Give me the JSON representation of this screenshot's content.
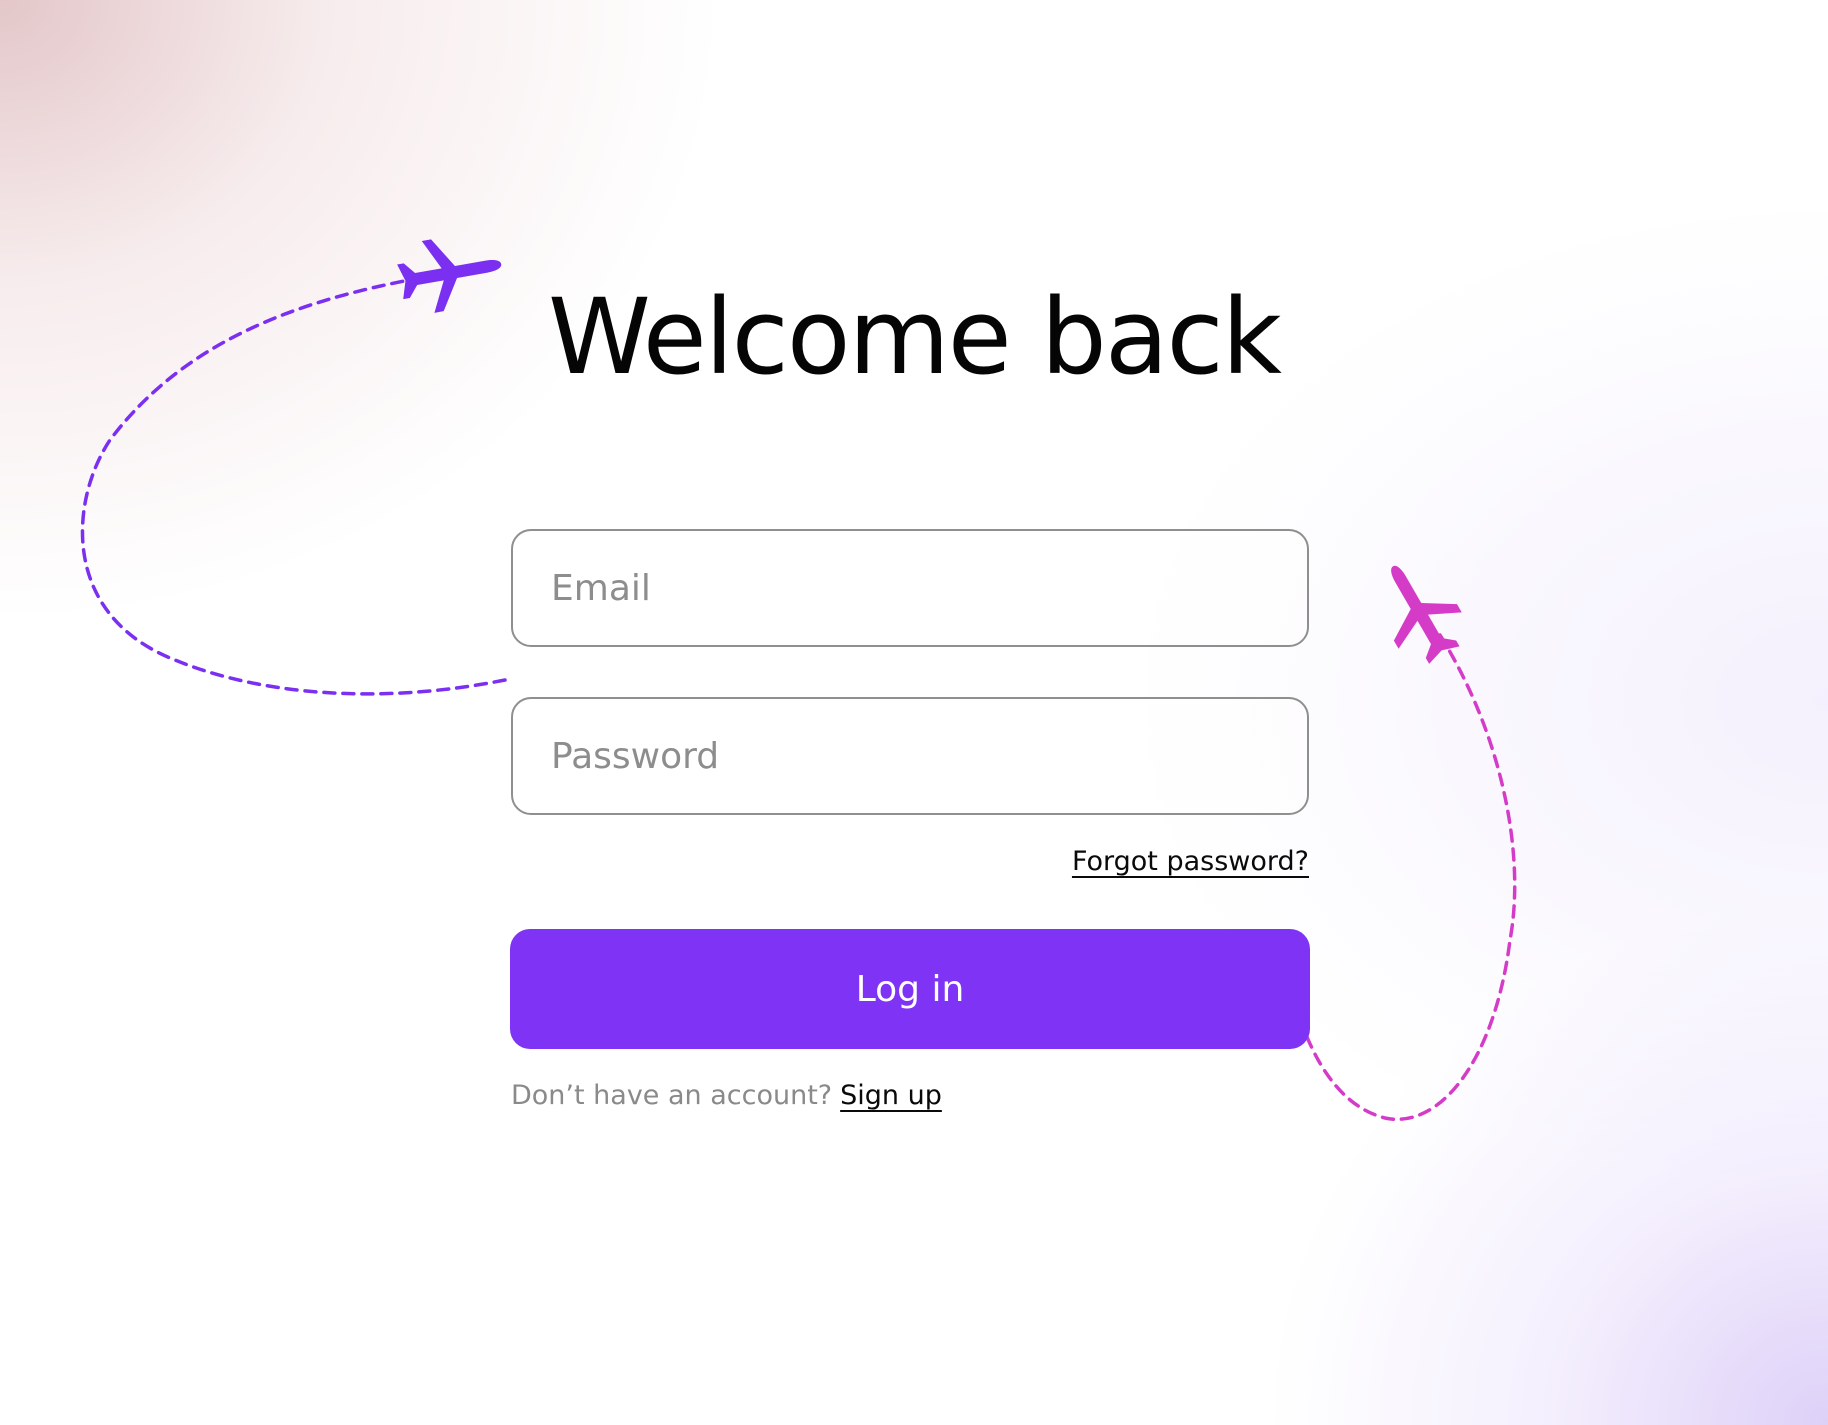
{
  "page": {
    "title": "Welcome back"
  },
  "form": {
    "email": {
      "placeholder": "Email",
      "value": ""
    },
    "password": {
      "placeholder": "Password",
      "value": ""
    },
    "forgot_link": "Forgot password?",
    "login_button": "Log in",
    "signup_prompt": "Don’t have an account?",
    "signup_link": "Sign up"
  },
  "colors": {
    "accent": "#7f34f5",
    "plane_left": "#7b2ff0",
    "plane_right": "#d43cc8"
  },
  "icons": {
    "left": "airplane-icon",
    "right": "airplane-icon"
  }
}
